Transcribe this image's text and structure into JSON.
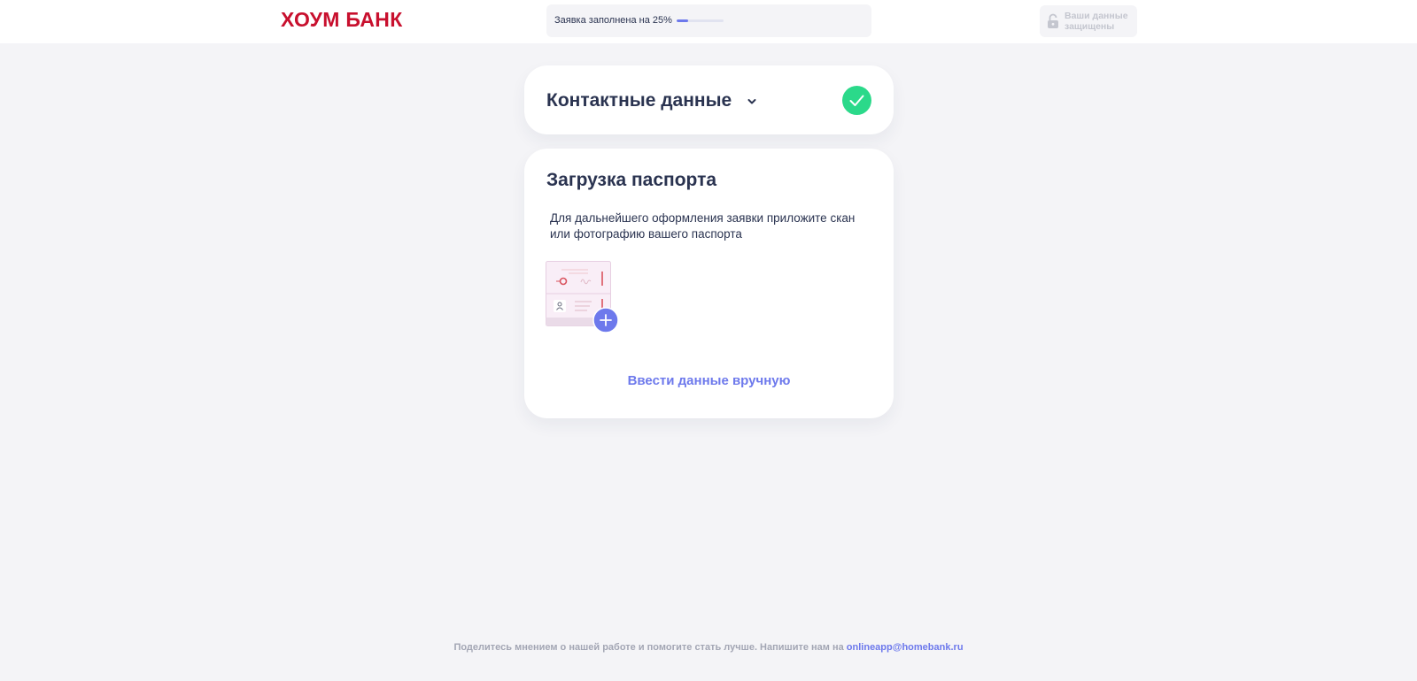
{
  "header": {
    "logo_text": "ХОУМ БАНК",
    "progress_label": "Заявка заполнена на 25%",
    "progress_fraction": 0.25,
    "security_label": "Ваши данные защищены"
  },
  "contacts": {
    "title": "Контактные данные",
    "status": "completed"
  },
  "passport": {
    "title": "Загрузка паспорта",
    "description": "Для дальнейшего оформления заявки приложите скан или фотографию вашего паспорта",
    "manual_entry_label": "Ввести данные вручную"
  },
  "footer": {
    "text": "Поделитесь мнением о нашей работе и помогите стать лучше. Напишите нам на ",
    "email": "onlineapp@homebank.ru"
  },
  "colors": {
    "brand": "#c8102e",
    "accent": "#6d79ec",
    "success": "#2bd98a",
    "background": "#f4f4f7"
  },
  "icons": [
    "lock-icon",
    "chevron-down-icon",
    "check-icon",
    "passport-upload-icon",
    "plus-icon",
    "person-icon"
  ]
}
